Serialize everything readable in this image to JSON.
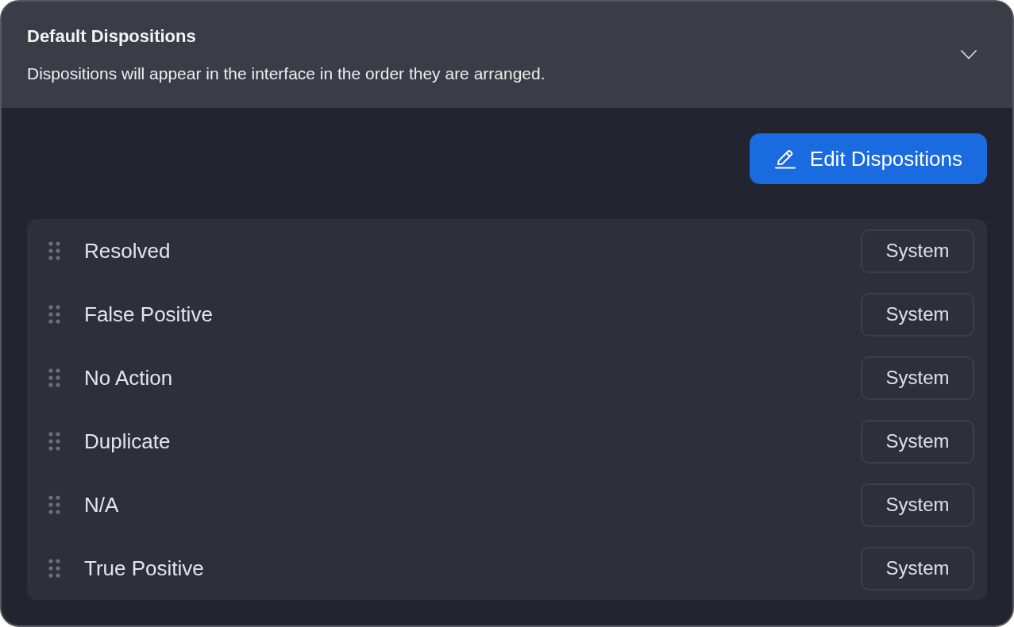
{
  "panel": {
    "title": "Default Dispositions",
    "description": "Dispositions will appear in the interface in the order they are arranged.",
    "expanded": true
  },
  "edit_button": {
    "label": "Edit Dispositions"
  },
  "dispositions": [
    {
      "name": "Resolved",
      "tag": "System"
    },
    {
      "name": "False Positive",
      "tag": "System"
    },
    {
      "name": "No Action",
      "tag": "System"
    },
    {
      "name": "Duplicate",
      "tag": "System"
    },
    {
      "name": "N/A",
      "tag": "System"
    },
    {
      "name": "True Positive",
      "tag": "System"
    }
  ]
}
